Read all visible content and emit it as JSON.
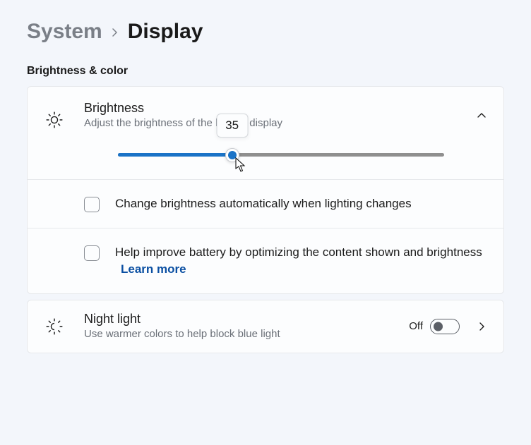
{
  "breadcrumb": {
    "parent": "System",
    "current": "Display"
  },
  "section_title": "Brightness & color",
  "brightness": {
    "title": "Brightness",
    "subtitle": "Adjust the brightness of the built-in display",
    "value": 35,
    "tooltip_value": "35",
    "auto_checkbox_label": "Change brightness automatically when lighting changes",
    "optimize_checkbox_label": "Help improve battery by optimizing the content shown and brightness",
    "learn_more_label": "Learn more"
  },
  "night_light": {
    "title": "Night light",
    "subtitle": "Use warmer colors to help block blue light",
    "toggle_state_label": "Off",
    "toggle_on": false
  },
  "colors": {
    "accent": "#1a73c7",
    "link": "#0a4fa2"
  }
}
